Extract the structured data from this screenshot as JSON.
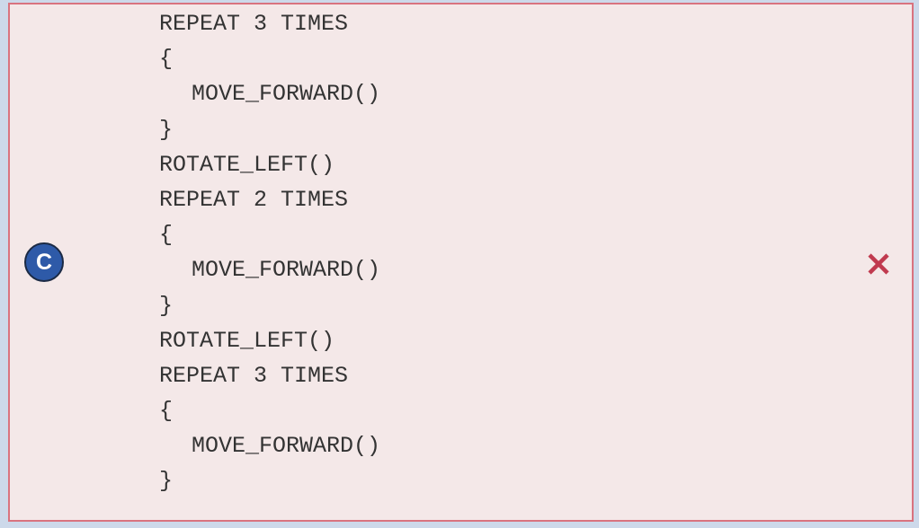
{
  "answer": {
    "option_label": "C",
    "status_icon": "x-mark-icon",
    "status_color": "#c03a4f",
    "card_background": "#f4e8e8",
    "card_border_color": "#d9737f",
    "badge_color": "#2e5aa8",
    "code_lines": [
      {
        "text": "REPEAT 3 TIMES"
      },
      {
        "text": "{"
      },
      {
        "text": "MOVE_FORWARD()"
      },
      {
        "text": "}"
      },
      {
        "text": "ROTATE_LEFT()"
      },
      {
        "text": "REPEAT 2 TIMES"
      },
      {
        "text": "{"
      },
      {
        "text": "MOVE_FORWARD()"
      },
      {
        "text": "}"
      },
      {
        "text": "ROTATE_LEFT()"
      },
      {
        "text": "REPEAT 3 TIMES"
      },
      {
        "text": "{"
      },
      {
        "text": "MOVE_FORWARD()"
      },
      {
        "text": "}"
      }
    ]
  }
}
